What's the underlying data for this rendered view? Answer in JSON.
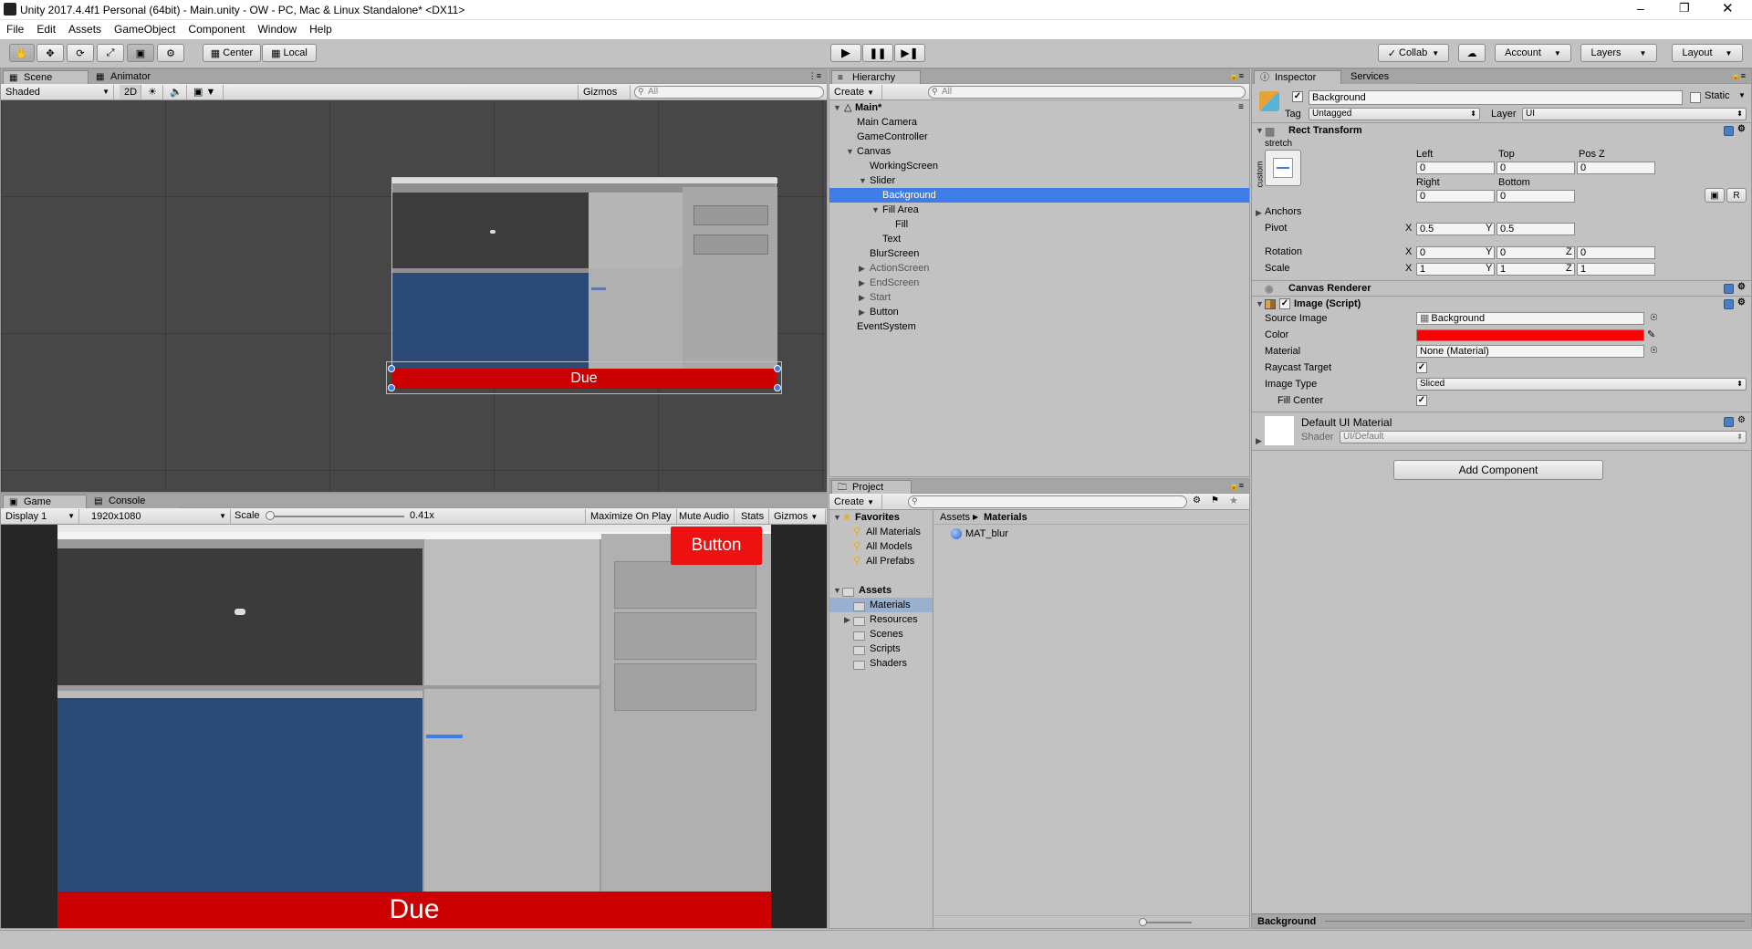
{
  "window": {
    "title": "Unity 2017.4.4f1 Personal (64bit) - Main.unity - OW - PC, Mac & Linux Standalone* <DX11>"
  },
  "menu": [
    "File",
    "Edit",
    "Assets",
    "GameObject",
    "Component",
    "Window",
    "Help"
  ],
  "toolbar": {
    "pivot_center": "Center",
    "pivot_local": "Local",
    "collab": "Collab",
    "account": "Account",
    "layers": "Layers",
    "layout": "Layout"
  },
  "scene": {
    "tabs": [
      "Scene",
      "Animator"
    ],
    "shading": "Shaded",
    "mode_2d": "2D",
    "gizmos": "Gizmos",
    "search_placeholder": "All",
    "slider_label": "Due"
  },
  "game": {
    "tabs": [
      "Game",
      "Console"
    ],
    "display": "Display 1",
    "resolution": "1920x1080",
    "scale_label": "Scale",
    "scale_value": "0.41x",
    "scale_fraction": 0.41,
    "buttons": [
      "Maximize On Play",
      "Mute Audio",
      "Stats",
      "Gizmos"
    ],
    "button_text": "Button",
    "slider_text": "Due"
  },
  "hierarchy": {
    "tab": "Hierarchy",
    "create": "Create",
    "search_placeholder": "All",
    "scene_name": "Main*",
    "items": [
      {
        "label": "Main Camera",
        "depth": 1
      },
      {
        "label": "GameController",
        "depth": 1
      },
      {
        "label": "Canvas",
        "depth": 1,
        "expanded": true
      },
      {
        "label": "WorkingScreen",
        "depth": 2
      },
      {
        "label": "Slider",
        "depth": 2,
        "expanded": true
      },
      {
        "label": "Background",
        "depth": 3,
        "selected": true
      },
      {
        "label": "Fill Area",
        "depth": 3,
        "expanded": true
      },
      {
        "label": "Fill",
        "depth": 4
      },
      {
        "label": "Text",
        "depth": 3
      },
      {
        "label": "BlurScreen",
        "depth": 2
      },
      {
        "label": "ActionScreen",
        "depth": 2,
        "collapsed": true
      },
      {
        "label": "EndScreen",
        "depth": 2,
        "collapsed": true
      },
      {
        "label": "Start",
        "depth": 2,
        "collapsed": true
      },
      {
        "label": "Button",
        "depth": 2,
        "collapsed": true
      },
      {
        "label": "EventSystem",
        "depth": 1
      }
    ]
  },
  "project": {
    "tab": "Project",
    "create": "Create",
    "favorites_label": "Favorites",
    "favorites": [
      "All Materials",
      "All Models",
      "All Prefabs"
    ],
    "assets_label": "Assets",
    "folders": [
      {
        "label": "Materials",
        "selected": true
      },
      {
        "label": "Resources",
        "collapsed": true
      },
      {
        "label": "Scenes"
      },
      {
        "label": "Scripts"
      },
      {
        "label": "Shaders"
      }
    ],
    "breadcrumb": [
      "Assets",
      "Materials"
    ],
    "files": [
      "MAT_blur"
    ]
  },
  "inspector": {
    "tabs": [
      "Inspector",
      "Services"
    ],
    "object_name": "Background",
    "static_label": "Static",
    "tag_label": "Tag",
    "tag_value": "Untagged",
    "layer_label": "Layer",
    "layer_value": "UI",
    "rect_transform": {
      "title": "Rect Transform",
      "anchor_preset_top": "stretch",
      "anchor_preset_side": "custom",
      "col_labels": [
        "Left",
        "Top",
        "Pos Z"
      ],
      "row1": [
        "0",
        "0",
        "0"
      ],
      "col_labels2": [
        "Right",
        "Bottom"
      ],
      "row2": [
        "0",
        "0"
      ],
      "anchors_label": "Anchors",
      "pivot_label": "Pivot",
      "pivot": {
        "x": "0.5",
        "y": "0.5"
      },
      "rotation_label": "Rotation",
      "rotation": {
        "x": "0",
        "y": "0",
        "z": "0"
      },
      "scale_label": "Scale",
      "scale": {
        "x": "1",
        "y": "1",
        "z": "1"
      },
      "r_button": "R",
      "axes": [
        "X",
        "Y",
        "Z"
      ]
    },
    "canvas_renderer": {
      "title": "Canvas Renderer"
    },
    "image": {
      "title": "Image (Script)",
      "source_image_label": "Source Image",
      "source_image": "Background",
      "color_label": "Color",
      "color": "#ff0000",
      "material_label": "Material",
      "material": "None (Material)",
      "raycast_label": "Raycast Target",
      "image_type_label": "Image Type",
      "image_type": "Sliced",
      "fill_center_label": "Fill Center"
    },
    "material": {
      "name": "Default UI Material",
      "shader_label": "Shader",
      "shader": "UI/Default"
    },
    "add_component": "Add Component",
    "footer": "Background"
  },
  "colors": {
    "accent": "#3e7de7",
    "ui_red": "#cc0000",
    "scene_blue": "#2b4a77"
  }
}
